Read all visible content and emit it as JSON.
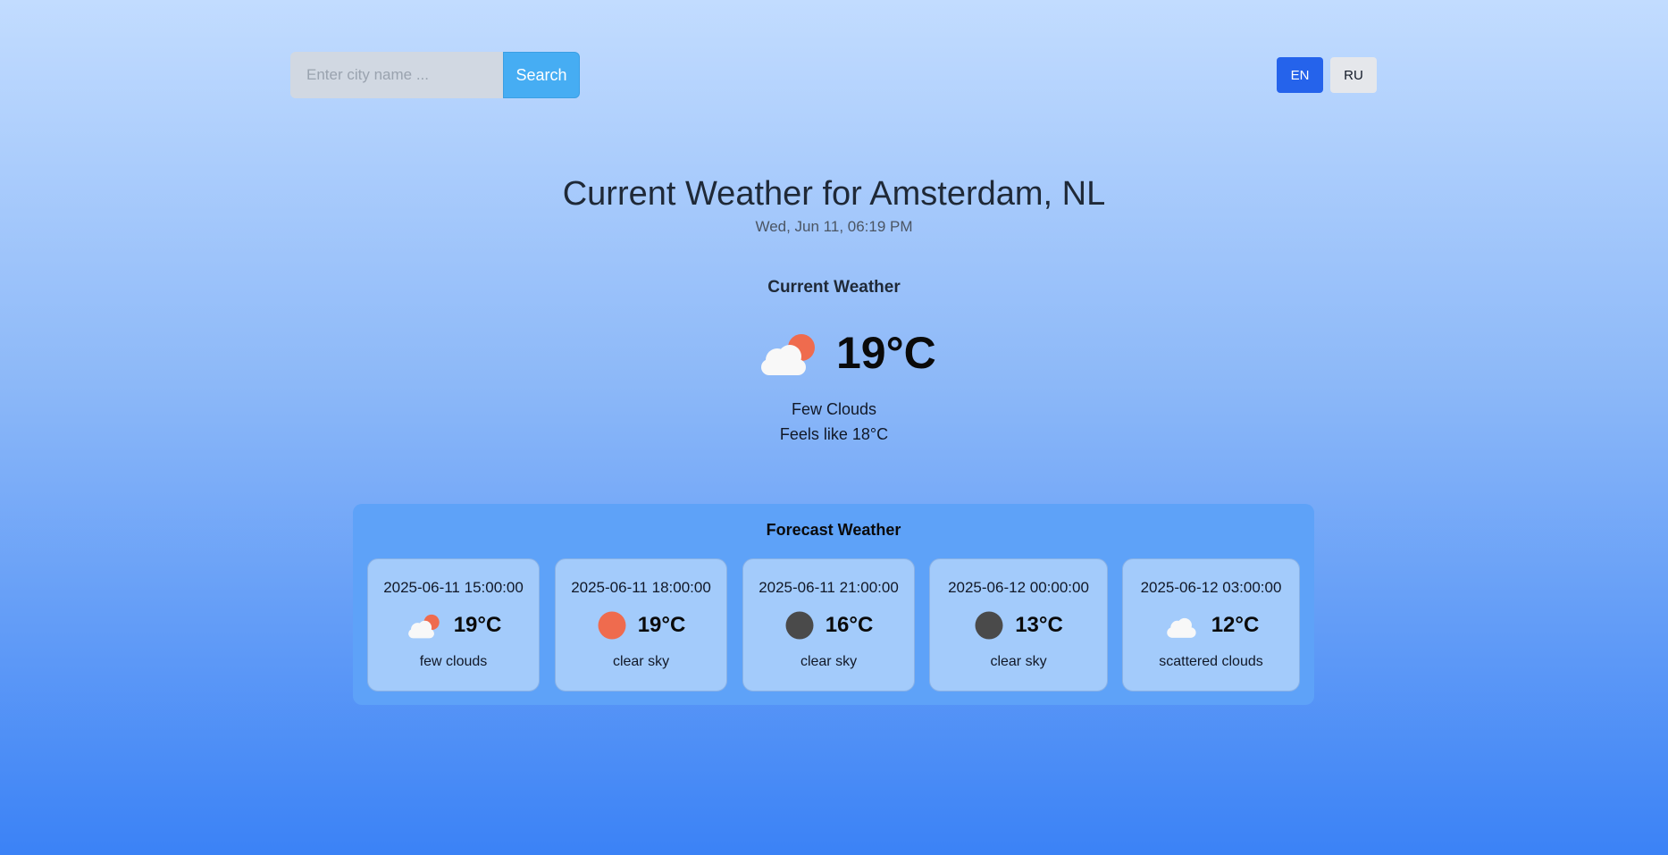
{
  "search": {
    "placeholder": "Enter city name ...",
    "button_label": "Search"
  },
  "language": {
    "options": [
      "EN",
      "RU"
    ],
    "selected": "EN"
  },
  "current": {
    "title": "Current Weather for Amsterdam, NL",
    "date": "Wed, Jun 11, 06:19 PM",
    "heading": "Current Weather",
    "icon": "few-clouds-icon",
    "temperature": "19°C",
    "description": "Few Clouds",
    "feels_like": "Feels like 18°C"
  },
  "forecast": {
    "heading": "Forecast Weather",
    "items": [
      {
        "time": "2025-06-11 15:00:00",
        "icon": "few-clouds-icon",
        "temperature": "19°C",
        "description": "few clouds"
      },
      {
        "time": "2025-06-11 18:00:00",
        "icon": "clear-sky-day-icon",
        "temperature": "19°C",
        "description": "clear sky"
      },
      {
        "time": "2025-06-11 21:00:00",
        "icon": "clear-sky-night-icon",
        "temperature": "16°C",
        "description": "clear sky"
      },
      {
        "time": "2025-06-12 00:00:00",
        "icon": "clear-sky-night-icon",
        "temperature": "13°C",
        "description": "clear sky"
      },
      {
        "time": "2025-06-12 03:00:00",
        "icon": "scattered-clouds-icon",
        "temperature": "12°C",
        "description": "scattered clouds"
      }
    ]
  },
  "colors": {
    "sun": "#ef6b4e",
    "moon": "#4a4a4a",
    "cloud": "#f8f8f8",
    "accent_button": "#46adf3",
    "active_language": "#2563eb"
  }
}
